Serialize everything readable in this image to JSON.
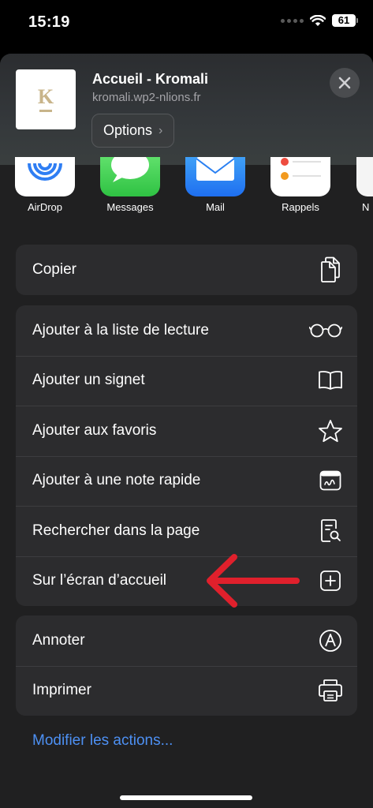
{
  "status": {
    "time": "15:19",
    "battery": "61"
  },
  "header": {
    "logo_letter": "K",
    "title": "Accueil - Kromali",
    "url": "kromali.wp2-nlions.fr",
    "options_label": "Options"
  },
  "apps": [
    {
      "label": "AirDrop",
      "icon": "airdrop-icon"
    },
    {
      "label": "Messages",
      "icon": "messages-icon"
    },
    {
      "label": "Mail",
      "icon": "mail-icon"
    },
    {
      "label": "Rappels",
      "icon": "reminders-icon"
    },
    {
      "label": "N",
      "icon": "notes-icon"
    }
  ],
  "actions": {
    "copy": "Copier",
    "reading_list": "Ajouter à la liste de lecture",
    "bookmark": "Ajouter un signet",
    "favorites": "Ajouter aux favoris",
    "quick_note": "Ajouter à une note rapide",
    "find_in_page": "Rechercher dans la page",
    "home_screen": "Sur l’écran d’accueil",
    "markup": "Annoter",
    "print": "Imprimer"
  },
  "edit_actions": "Modifier les actions...",
  "colors": {
    "accent": "#4d90f3",
    "arrow": "#e0202c",
    "sheet": "#202021",
    "group": "#2c2c2e"
  }
}
